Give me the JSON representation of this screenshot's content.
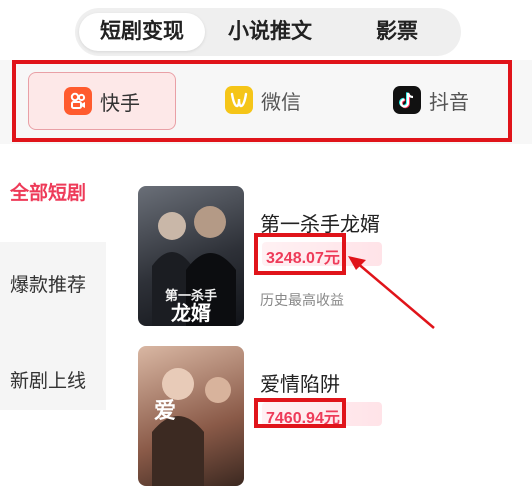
{
  "top_tabs": [
    {
      "label": "短剧变现",
      "active": true
    },
    {
      "label": "小说推文",
      "active": false
    },
    {
      "label": "影票",
      "active": false
    }
  ],
  "platforms": [
    {
      "label": "快手",
      "icon": "kuaishou-icon",
      "active": true
    },
    {
      "label": "微信",
      "icon": "weixin-icon",
      "active": false
    },
    {
      "label": "抖音",
      "icon": "douyin-icon",
      "active": false
    }
  ],
  "sidebar": {
    "items": [
      {
        "label": "全部短剧",
        "active": true
      },
      {
        "label": "爆款推荐",
        "active": false
      },
      {
        "label": "新剧上线",
        "active": false
      }
    ]
  },
  "dramas": [
    {
      "title": "第一杀手龙婿",
      "price": "3248.07元",
      "hint": "历史最高收益",
      "poster_text": "第一杀手 龙婿"
    },
    {
      "title": "爱情陷阱",
      "price": "7460.94元",
      "hint": "",
      "poster_text": "爱"
    }
  ],
  "colors": {
    "accent": "#ee3b59",
    "annotation_red": "#e0141a",
    "kuaishou": "#ff5b2e",
    "weixin": "#f5c518",
    "douyin": "#111111"
  }
}
